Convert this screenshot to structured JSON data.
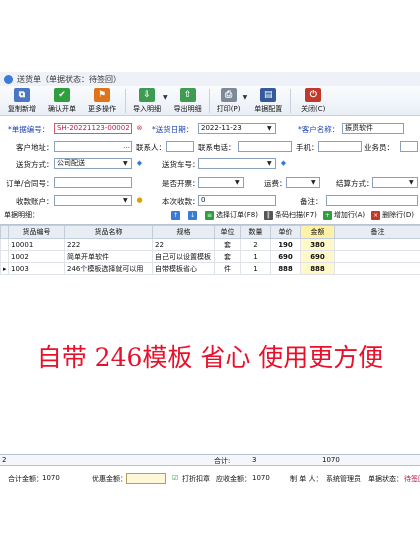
{
  "window": {
    "title": "送货单（单据状态：待签回）"
  },
  "toolbar": {
    "buttons": [
      {
        "label": "复制新增",
        "icon": "copy-add-icon"
      },
      {
        "label": "确认开单",
        "icon": "check-icon"
      },
      {
        "label": "更多操作",
        "icon": "flag-icon"
      },
      {
        "label": "导入明细",
        "icon": "import-icon"
      },
      {
        "label": "导出明细",
        "icon": "export-icon"
      },
      {
        "label": "打印(P)",
        "icon": "printer-icon"
      },
      {
        "label": "单据配置",
        "icon": "config-icon"
      },
      {
        "label": "关闭(C)",
        "icon": "close-door-icon"
      }
    ]
  },
  "form": {
    "bill_no_label": "单据编号：",
    "bill_no": "SH-20221123-00002",
    "date_label": "送货日期：",
    "date": "2022-11-23",
    "customer_name_label": "客户名称：",
    "customer_name": "振贯软件",
    "address_label": "客户地址：",
    "address": "",
    "contact_label": "联系人：",
    "contact": "",
    "phone_label": "联系电话：",
    "phone": "",
    "mobile_label": "手机：",
    "mobile": "",
    "salesman_label": "业务员：",
    "salesman": "",
    "ship_method_label": "送货方式：",
    "ship_method": "公司配送",
    "plate_label": "送货车号：",
    "plate": "",
    "order_no_label": "订单/合同号：",
    "order_no": "",
    "invoice_label": "是否开票：",
    "invoice": "",
    "freight_label": "运费：",
    "freight": "",
    "settle_label": "结算方式：",
    "settle": "",
    "receiver_label": "收款账户：",
    "receiver": "",
    "received_label": "本次收款：",
    "received": "0",
    "remark_label": "备注：",
    "remark": ""
  },
  "detail_label": "单据明细：",
  "grid_toolbar": {
    "select_order": "选择订单(F8)",
    "barcode_scan": "条码扫描(F7)",
    "add_row": "增加行(A)",
    "delete_row": "删除行(D)"
  },
  "grid": {
    "headers": [
      "货品编号",
      "货品名称",
      "规格",
      "单位",
      "数量",
      "单价",
      "金额",
      "备注"
    ],
    "rows": [
      [
        "10001",
        "222",
        "22",
        "套",
        "2",
        "190",
        "380",
        ""
      ],
      [
        "1002",
        "简单开单软件",
        "自己可以设置模板",
        "套",
        "1",
        "690",
        "690",
        ""
      ],
      [
        "1003",
        "246个模板选择就可以用",
        "自带模板省心",
        "件",
        "1",
        "888",
        "888",
        ""
      ]
    ],
    "row_markers": [
      "",
      "",
      "▸"
    ],
    "total_label": "合计:",
    "total_qty": "3",
    "total_amount": "1070",
    "row_count": "2"
  },
  "promo_text": "自带 246模板 省心 使用更方便",
  "footer": {
    "total_label": "合计金额：",
    "total": "1070",
    "discount_label": "优惠金额：",
    "discount": "",
    "print_stamp": "打折扣章",
    "receivable_label": "应收金额：",
    "receivable": "1070",
    "maker_label": "制 单 人：",
    "maker": "系统管理员",
    "status_label": "单据状态：",
    "status": "待签回"
  },
  "colors": {
    "promo": "#e8102a",
    "required": "#1a3fb3",
    "bill_no": "#c0183c",
    "amount_bg": "#fff8c8"
  }
}
